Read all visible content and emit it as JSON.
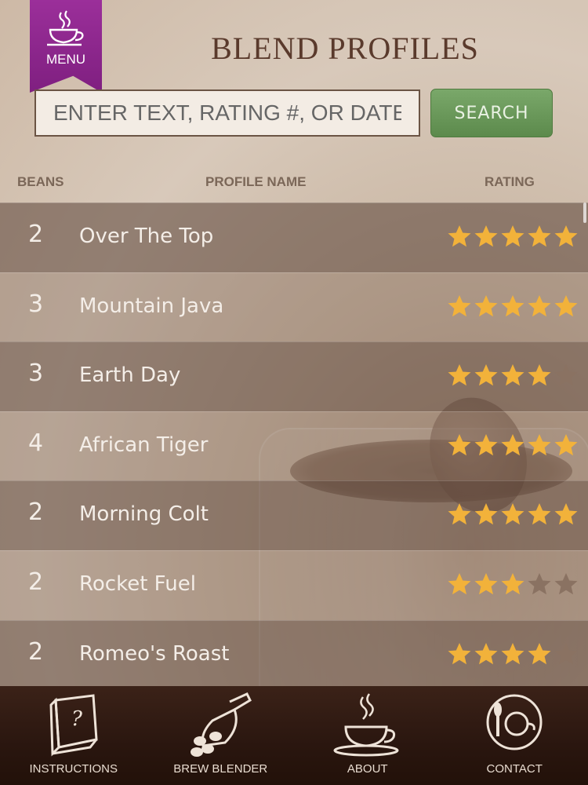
{
  "header": {
    "menu_label": "MENU",
    "title": "BLEND PROFILES"
  },
  "search": {
    "placeholder": "ENTER TEXT, RATING #, OR DATE",
    "button_label": "SEARCH"
  },
  "columns": {
    "beans": "BEANS",
    "profile_name": "PROFILE NAME",
    "rating": "RATING"
  },
  "profiles": [
    {
      "beans": "2",
      "name": "Over The Top",
      "rating": 5
    },
    {
      "beans": "3",
      "name": "Mountain Java",
      "rating": 5
    },
    {
      "beans": "3",
      "name": "Earth Day",
      "rating": 4
    },
    {
      "beans": "4",
      "name": "African Tiger",
      "rating": 5
    },
    {
      "beans": "2",
      "name": "Morning Colt",
      "rating": 5
    },
    {
      "beans": "2",
      "name": "Rocket Fuel",
      "rating": 3
    },
    {
      "beans": "2",
      "name": "Romeo's Roast",
      "rating": 4
    }
  ],
  "rating_max": 5,
  "tabs": [
    {
      "label": "INSTRUCTIONS",
      "icon": "book-question-icon"
    },
    {
      "label": "BREW BLENDER",
      "icon": "coffee-scoop-icon"
    },
    {
      "label": "ABOUT",
      "icon": "steaming-cup-icon"
    },
    {
      "label": "CONTACT",
      "icon": "plate-cup-icon"
    }
  ],
  "colors": {
    "menu_ribbon": "#8b2a8c",
    "search_button": "#6a985a",
    "star_filled": "#f2b23a",
    "star_empty": "#8a7262",
    "title": "#5a3a2c"
  }
}
